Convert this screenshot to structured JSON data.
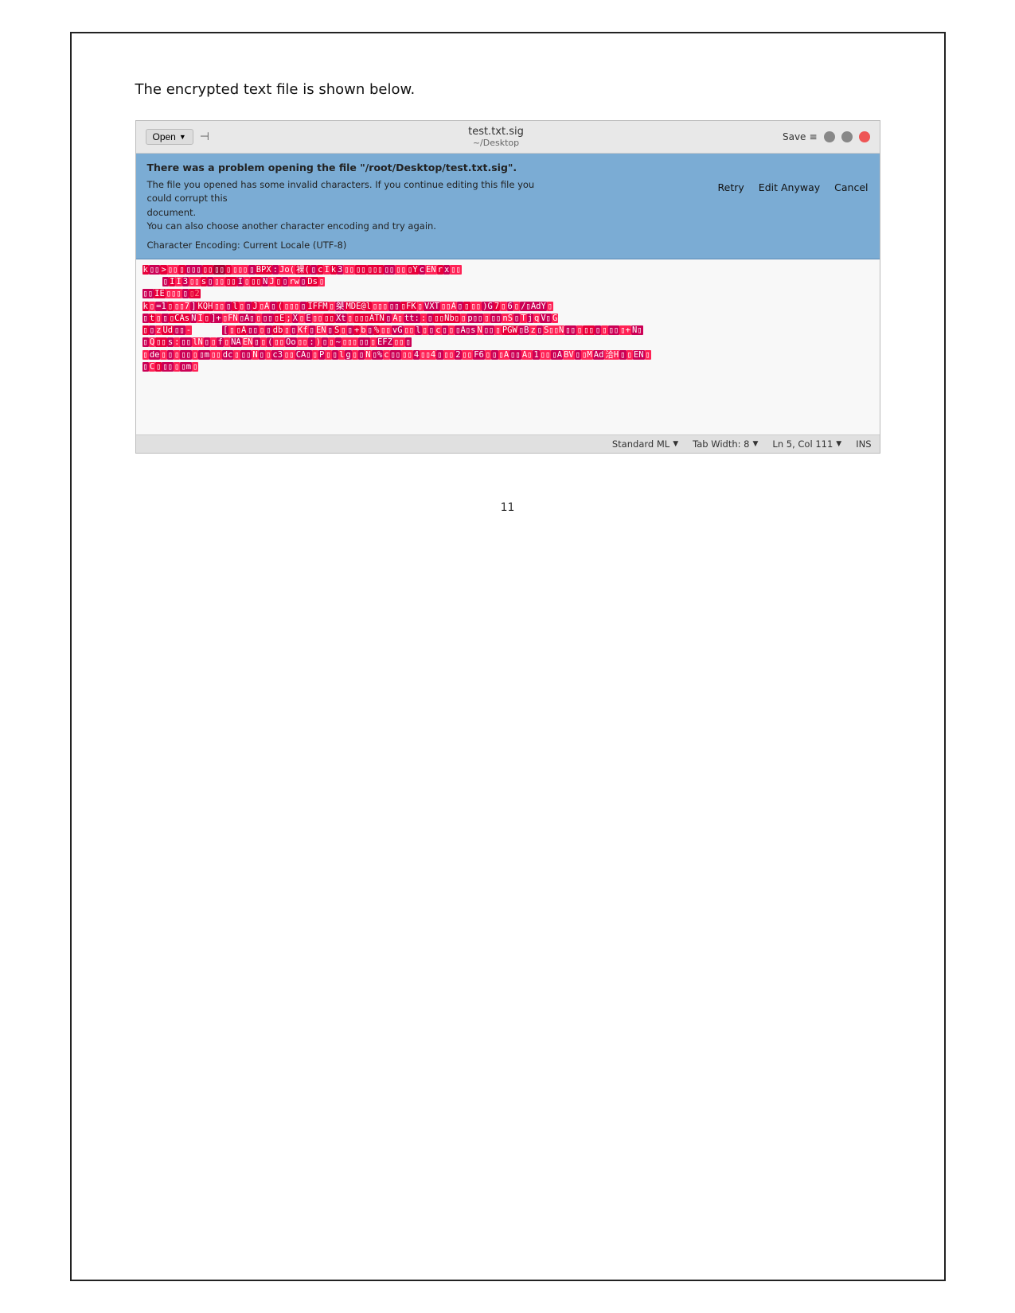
{
  "intro": {
    "text": "The encrypted text file is shown below."
  },
  "titlebar": {
    "open_label": "Open",
    "pin_icon": "📌",
    "filename": "test.txt.sig",
    "filepath": "~/Desktop",
    "save_label": "Save",
    "menu_icon": "≡",
    "btn_min": "–",
    "btn_max": "□",
    "btn_close": "✕"
  },
  "error": {
    "title": "There was a problem opening the file \"/root/Desktop/test.txt.sig\".",
    "line1": "The file you opened has some invalid characters. If you continue editing this file you could corrupt this",
    "line2": "document.",
    "line3": "You can also choose another character encoding and try again.",
    "encoding_label": "Character Encoding:",
    "encoding_value": "Current Locale (UTF-8)",
    "btn_retry": "Retry",
    "btn_edit": "Edit Anyway",
    "btn_cancel": "Cancel"
  },
  "statusbar": {
    "language": "Standard ML",
    "tab_width": "Tab Width: 8",
    "position": "Ln 5, Col 111",
    "ins": "INS"
  },
  "page_number": "11"
}
